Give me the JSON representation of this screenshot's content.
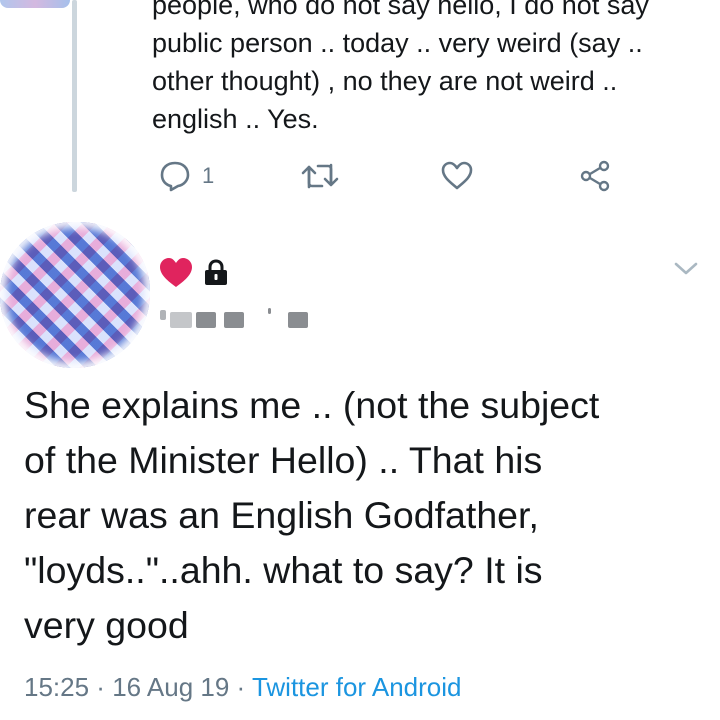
{
  "previous_tweet": {
    "lines": [
      "people, who do not say hello, I do not say",
      "public person .. today .. very weird (say ..",
      "other thought) , no they are not weird ..",
      "english .. Yes."
    ],
    "actions": {
      "reply_count": "1"
    }
  },
  "tweet": {
    "lines": [
      "She explains me .. (not the subject",
      "of the Minister Hello) .. That his",
      "rear was an English Godfather,",
      "\"loyds..\"..ahh. what to say? It is",
      "very good"
    ],
    "time": "15:25",
    "sep1": " · ",
    "date": "16 Aug 19",
    "sep2": " · ",
    "source": "Twitter for Android"
  },
  "colors": {
    "text": "#14171a",
    "muted": "#657786",
    "link": "#1b95e0",
    "heart": "#e0245e",
    "thread_line": "#ccd6dd"
  },
  "icons": [
    "reply-icon",
    "retweet-icon",
    "like-icon",
    "share-icon",
    "red-heart-icon",
    "lock-icon",
    "chevron-down-icon"
  ]
}
